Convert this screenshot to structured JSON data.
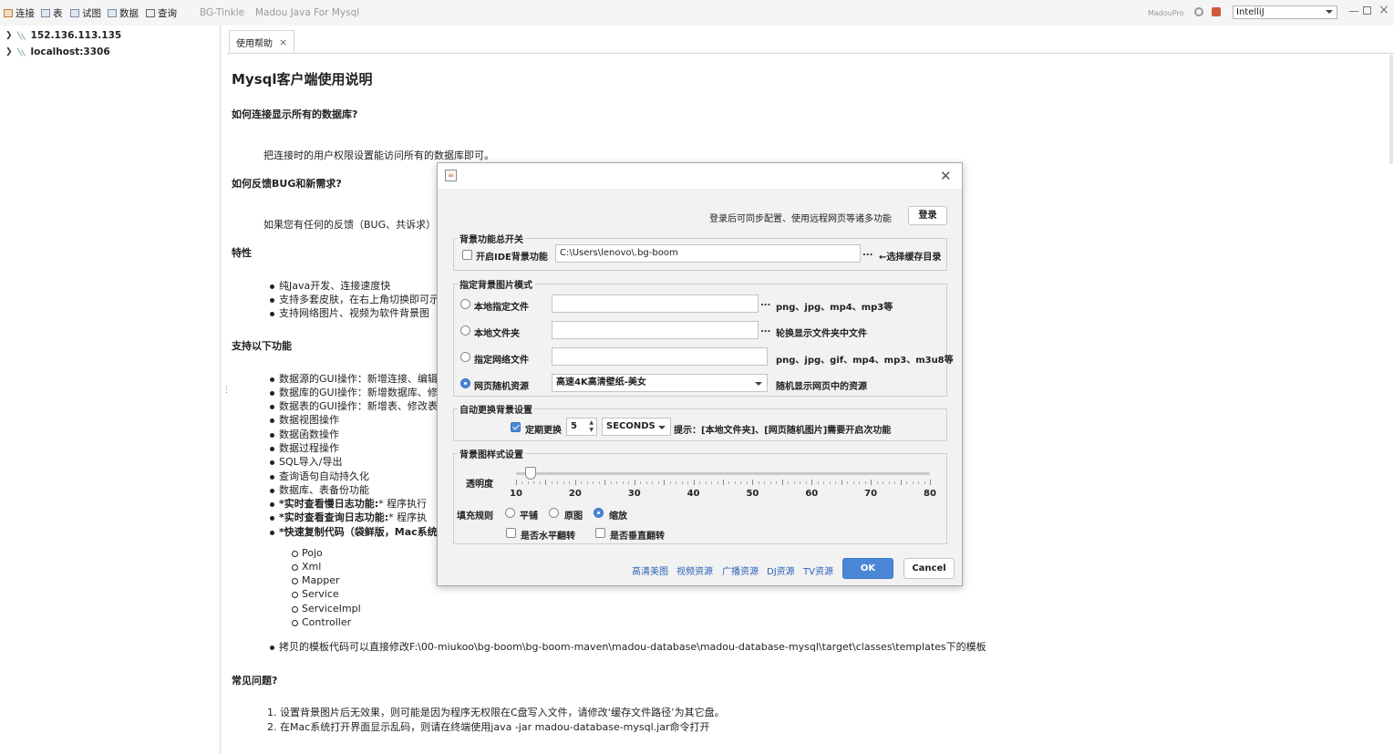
{
  "toolbar": {
    "items": [
      "连接",
      "表",
      "试图",
      "数据",
      "查询"
    ],
    "titles": [
      "BG-Tinkle",
      "Madou Java For Mysql"
    ],
    "brand": "MadouPro",
    "skin": "IntelliJ"
  },
  "connections": [
    "152.136.113.135",
    "localhost:3306"
  ],
  "tab": {
    "label": "使用帮助"
  },
  "doc": {
    "title": "Mysql客户端使用说明",
    "q1": "如何连接显示所有的数据库?",
    "a1": "把连接时的用户权限设置能访问所有的数据库即可。",
    "q2": "如何反馈BUG和新需求?",
    "a2": "如果您有任何的反馈（BUG、共诉求）",
    "features_title": "特性",
    "features": [
      "纯Java开发、连接速度快",
      "支持多套皮肤，在右上角切换即可示",
      "支持网络图片、视频为软件背景图"
    ],
    "functions_title": "支持以下功能",
    "functions": [
      "数据源的GUI操作：新增连接、编辑",
      "数据库的GUI操作：新增数据库、修",
      "数据表的GUI操作：新增表、修改表",
      "数据视图操作",
      "数据函数操作",
      "数据过程操作",
      "SQL导入/导出",
      "查询语句自动持久化",
      "数据库、表备份功能"
    ],
    "bold_items": [
      {
        "label": "*实时查看慢日志功能:",
        "rest": "* 程序执行"
      },
      {
        "label": "*实时查看查询日志功能:",
        "rest": "* 程序执"
      },
      {
        "label": "*快速复制代码（袋鲜版，Mac系统",
        "rest": ""
      }
    ],
    "sub_items": [
      "Pojo",
      "Xml",
      "Mapper",
      "Service",
      "ServiceImpl",
      "Controller"
    ],
    "template_note": "拷贝的模板代码可以直接修改F:\\00-miukoo\\bg-boom\\bg-boom-maven\\madou-database\\madou-database-mysql\\target\\classes\\templates下的模板",
    "faq_title": "常见问题?",
    "faq": [
      "1. 设置背景图片后无效果，则可能是因为程序无权限在C盘写入文件，请修改‘缓存文件路径’为其它盘。",
      "2. 在Mac系统打开界面显示乱码，则请在终端使用java -jar madou-database-mysql.jar命令打开"
    ]
  },
  "dialog": {
    "login_hint": "登录后可同步配置、使用远程网页等诸多功能",
    "login_button": "登录",
    "group_master": "背景功能总开关",
    "enable_label": "开启IDE背景功能",
    "cache_path": "C:\\Users\\lenovo\\.bg-boom",
    "cache_dots": "...",
    "cache_hint": "←选择缓存目录",
    "group_mode": "指定背景图片模式",
    "modes": [
      {
        "label": "本地指定文件",
        "value": "",
        "dots": "...",
        "hint": "png、jpg、mp4、mp3等",
        "checked": false
      },
      {
        "label": "本地文件夹",
        "value": "",
        "dots": "...",
        "hint": "轮换显示文件夹中文件",
        "checked": false
      },
      {
        "label": "指定网络文件",
        "value": "",
        "dots": "",
        "hint": "png、jpg、gif、mp4、mp3、m3u8等",
        "checked": false
      },
      {
        "label": "网页随机资源",
        "value": "高速4K高清壁纸-美女",
        "dots": "",
        "hint": "随机显示网页中的资源",
        "checked": true
      }
    ],
    "group_auto": "自动更换背景设置",
    "auto_label": "定期更换",
    "auto_value": "5",
    "auto_unit": "SECONDS",
    "auto_hint": "提示：[本地文件夹]、[网页随机图片]需要开启次功能",
    "group_style": "背景图样式设置",
    "opacity_label": "透明度",
    "opacity_value": 12.5,
    "slider_min": 10,
    "slider_max": 80,
    "slider_ticks": [
      "10",
      "20",
      "30",
      "40",
      "50",
      "60",
      "70",
      "80"
    ],
    "fill_label": "填充规则",
    "fill_options": [
      {
        "label": "平铺",
        "checked": false
      },
      {
        "label": "原图",
        "checked": false
      },
      {
        "label": "缩放",
        "checked": true
      }
    ],
    "flip_h": "是否水平翻转",
    "flip_v": "是否垂直翻转",
    "links": [
      "高清美图",
      "视频资源",
      "广播资源",
      "DJ资源",
      "TV资源"
    ],
    "ok": "OK",
    "cancel": "Cancel"
  }
}
